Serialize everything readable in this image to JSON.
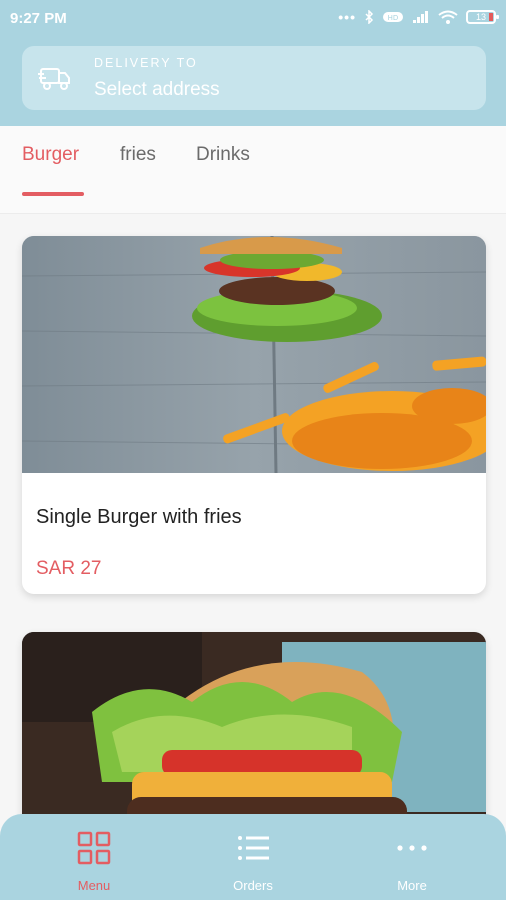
{
  "status_bar": {
    "time": "9:27 PM",
    "battery": "13"
  },
  "delivery": {
    "label": "DELIVERY TO",
    "value": "Select address",
    "icon": "truck-icon"
  },
  "tabs": [
    {
      "label": "Burger",
      "active": true
    },
    {
      "label": "fries",
      "active": false
    },
    {
      "label": "Drinks",
      "active": false
    }
  ],
  "products": [
    {
      "name": "Single Burger with fries",
      "price": "SAR 27",
      "image": "burger-with-fries-photo"
    },
    {
      "name": "",
      "price": "",
      "image": "burger-closeup-photo"
    }
  ],
  "bottom_nav": [
    {
      "label": "Menu",
      "icon": "grid-icon",
      "active": true
    },
    {
      "label": "Orders",
      "icon": "list-icon",
      "active": false
    },
    {
      "label": "More",
      "icon": "more-dots-icon",
      "active": false
    }
  ],
  "colors": {
    "header_bg": "#aad4e0",
    "accent": "#e35d62",
    "delivery_box_bg": "#c7e4ec"
  }
}
